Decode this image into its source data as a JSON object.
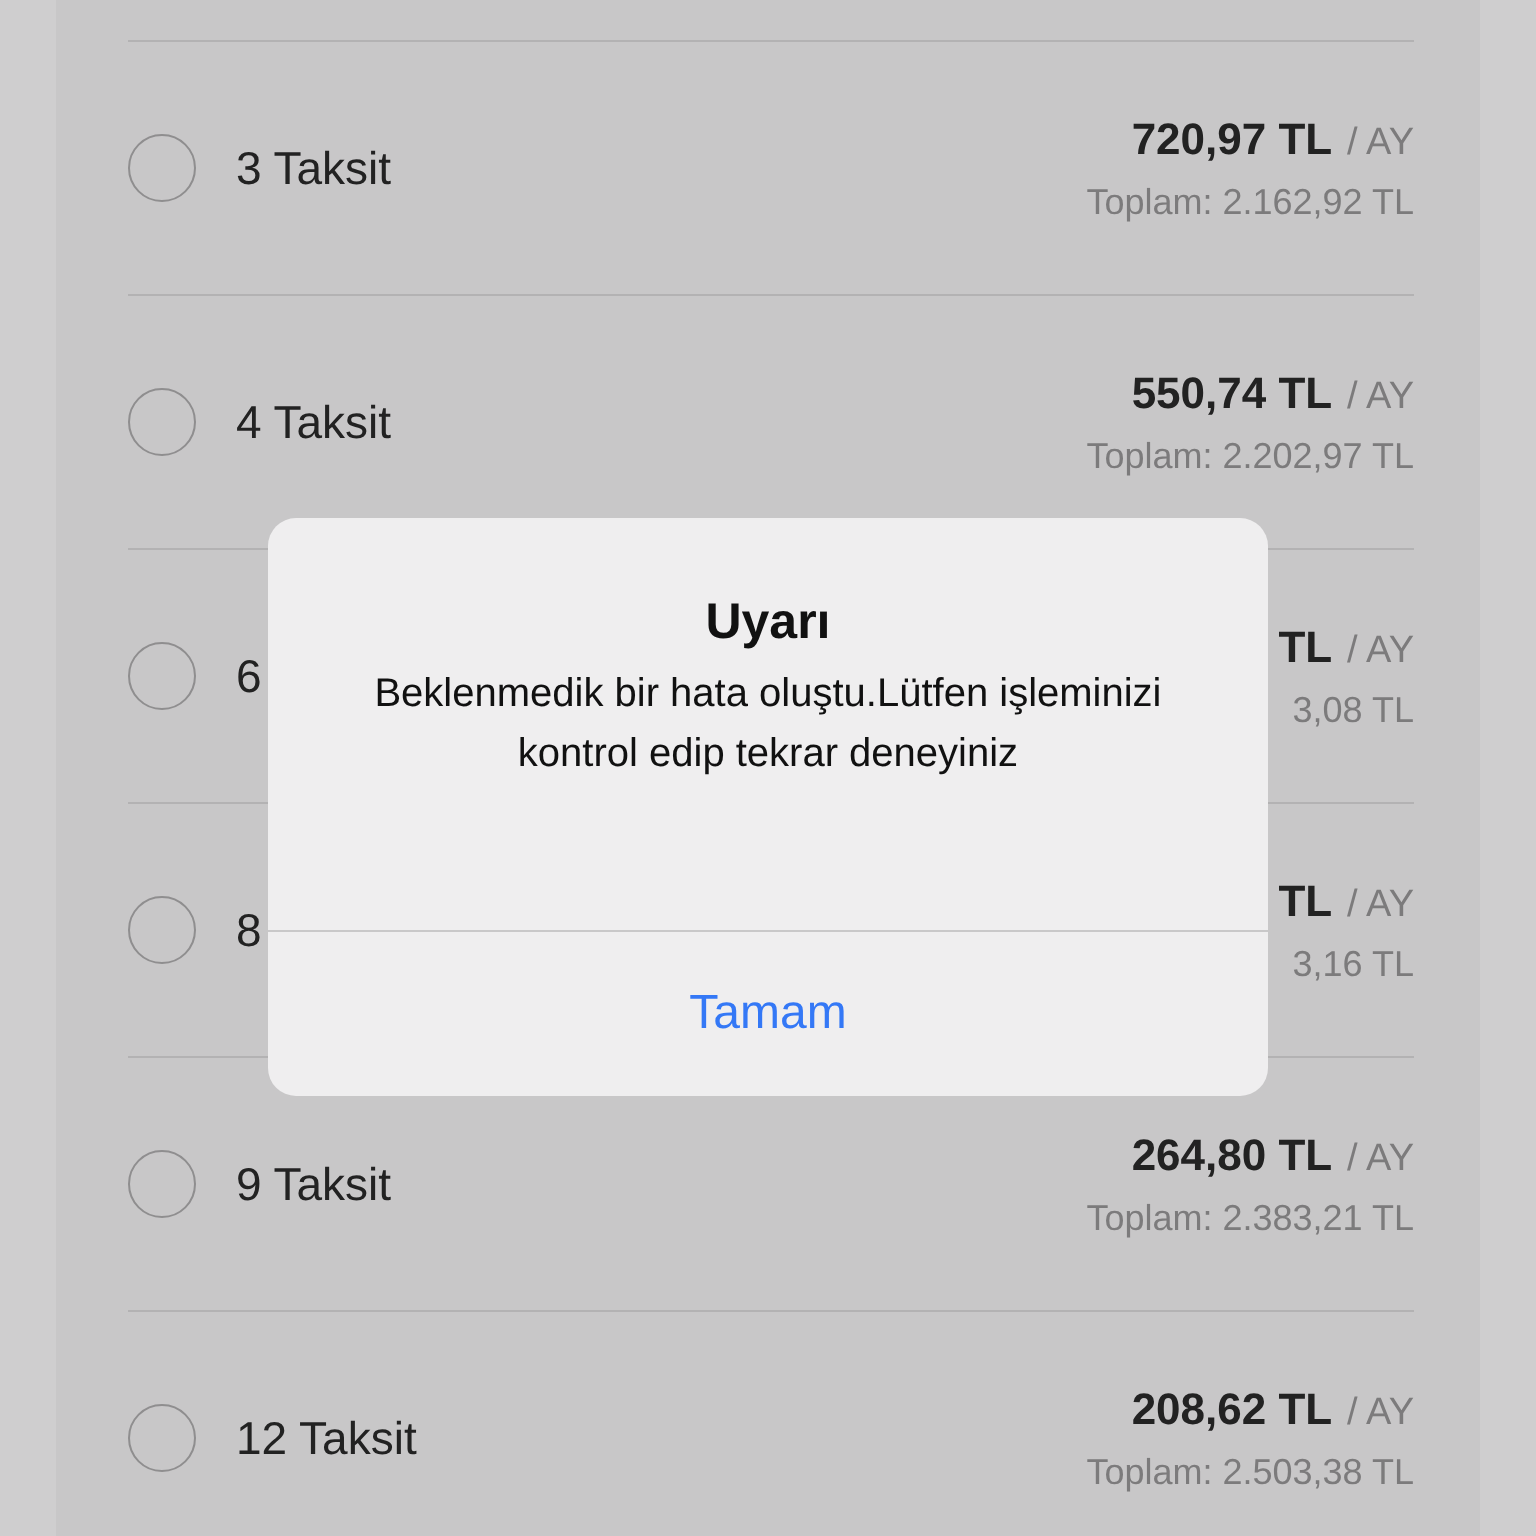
{
  "installments": [
    {
      "label": "3 Taksit",
      "amount": "720,97 TL",
      "unit": "/ AY",
      "total": "Toplam: 2.162,92 TL",
      "selected": false
    },
    {
      "label": "4 Taksit",
      "amount": "550,74 TL",
      "unit": "/ AY",
      "total": "Toplam: 2.202,97 TL",
      "selected": false
    },
    {
      "label": "6",
      "amount": "TL",
      "unit": "/ AY",
      "total": "3,08 TL",
      "selected": false
    },
    {
      "label": "8",
      "amount": "TL",
      "unit": "/ AY",
      "total": "3,16 TL",
      "selected": false
    },
    {
      "label": "9 Taksit",
      "amount": "264,80 TL",
      "unit": "/ AY",
      "total": "Toplam: 2.383,21 TL",
      "selected": false
    },
    {
      "label": "12 Taksit",
      "amount": "208,62 TL",
      "unit": "/ AY",
      "total": "Toplam: 2.503,38 TL",
      "selected": false
    }
  ],
  "alert": {
    "title": "Uyarı",
    "message": "Beklenmedik bir hata oluştu.Lütfen işleminizi kontrol edip tekrar deneyiniz",
    "button": "Tamam"
  }
}
